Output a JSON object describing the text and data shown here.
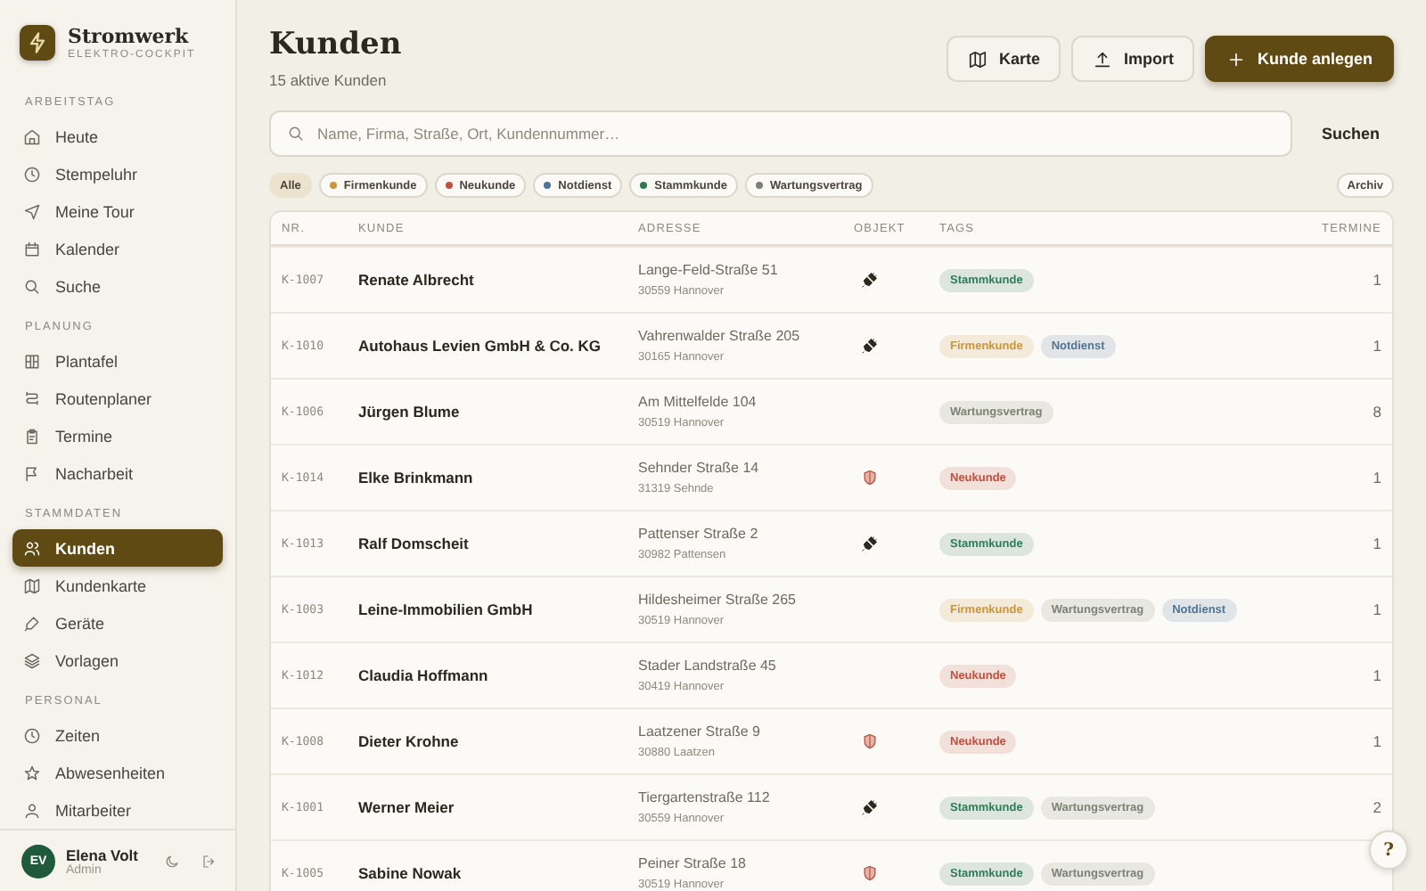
{
  "brand": {
    "name": "Stromwerk",
    "subtitle": "ELEKTRO-COCKPIT"
  },
  "sidebar": {
    "sections": [
      {
        "title": "ARBEITSTAG",
        "items": [
          {
            "label": "Heute",
            "selected": false
          },
          {
            "label": "Stempeluhr",
            "selected": false
          },
          {
            "label": "Meine Tour",
            "selected": false
          },
          {
            "label": "Kalender",
            "selected": false
          },
          {
            "label": "Suche",
            "selected": false
          }
        ]
      },
      {
        "title": "PLANUNG",
        "items": [
          {
            "label": "Plantafel",
            "selected": false
          },
          {
            "label": "Routenplaner",
            "selected": false
          },
          {
            "label": "Termine",
            "selected": false
          },
          {
            "label": "Nacharbeit",
            "selected": false
          }
        ]
      },
      {
        "title": "STAMMDATEN",
        "items": [
          {
            "label": "Kunden",
            "selected": true
          },
          {
            "label": "Kundenkarte",
            "selected": false
          },
          {
            "label": "Geräte",
            "selected": false
          },
          {
            "label": "Vorlagen",
            "selected": false
          }
        ]
      },
      {
        "title": "PERSONAL",
        "items": [
          {
            "label": "Zeiten",
            "selected": false
          },
          {
            "label": "Abwesenheiten",
            "selected": false
          },
          {
            "label": "Mitarbeiter",
            "selected": false
          }
        ]
      }
    ]
  },
  "user": {
    "initials": "EV",
    "name": "Elena Volt",
    "role": "Admin"
  },
  "page": {
    "title": "Kunden",
    "subtitle": "15 aktive Kunden"
  },
  "actions": [
    {
      "label": "Karte",
      "kind": "secondary"
    },
    {
      "label": "Import",
      "kind": "secondary"
    },
    {
      "label": "Kunde anlegen",
      "kind": "primary"
    }
  ],
  "search": {
    "placeholder": "Name, Firma, Straße, Ort, Kundennummer…",
    "button": "Suchen"
  },
  "filters": [
    {
      "label": "Alle",
      "selected": true
    },
    {
      "label": "Firmenkunde",
      "selected": false,
      "color": "#c9963a"
    },
    {
      "label": "Neukunde",
      "selected": false,
      "color": "#c0513f"
    },
    {
      "label": "Notdienst",
      "selected": false,
      "color": "#4f7594"
    },
    {
      "label": "Stammkunde",
      "selected": false,
      "color": "#2f7a57"
    },
    {
      "label": "Wartungsvertrag",
      "selected": false,
      "color": "#7d8273"
    }
  ],
  "archive": "Archiv",
  "table": {
    "columns": [
      "NR.",
      "KUNDE",
      "ADRESSE",
      "OBJEKT",
      "TAGS",
      "TERMINE"
    ],
    "rows": [
      {
        "nr": "K-1007",
        "name": "Renate Albrecht",
        "street": "Lange-Feld-Straße 51",
        "city": "30559 Hannover",
        "object": {
          "kind": "plug"
        },
        "tags": [
          {
            "label": "Stammkunde",
            "color": "#2f7a57"
          }
        ],
        "termine": "1"
      },
      {
        "nr": "K-1010",
        "name": "Autohaus Levien GmbH & Co. KG",
        "street": "Vahrenwalder Straße 205",
        "city": "30165 Hannover",
        "object": {
          "kind": "plug"
        },
        "tags": [
          {
            "label": "Firmenkunde",
            "color": "#c9963a"
          },
          {
            "label": "Notdienst",
            "color": "#4f7594"
          }
        ],
        "termine": "1"
      },
      {
        "nr": "K-1006",
        "name": "Jürgen Blume",
        "street": "Am Mittelfelde 104",
        "city": "30519 Hannover",
        "tags": [
          {
            "label": "Wartungsvertrag",
            "color": "#7d8273"
          }
        ],
        "termine": "8"
      },
      {
        "nr": "K-1014",
        "name": "Elke Brinkmann",
        "street": "Sehnder Straße 14",
        "city": "31319 Sehnde",
        "object": {
          "kind": "shield"
        },
        "tags": [
          {
            "label": "Neukunde",
            "color": "#c0513f"
          }
        ],
        "termine": "1"
      },
      {
        "nr": "K-1013",
        "name": "Ralf Domscheit",
        "street": "Pattenser Straße 2",
        "city": "30982 Pattensen",
        "object": {
          "kind": "plug"
        },
        "tags": [
          {
            "label": "Stammkunde",
            "color": "#2f7a57"
          }
        ],
        "termine": "1"
      },
      {
        "nr": "K-1003",
        "name": "Leine-Immobilien GmbH",
        "street": "Hildesheimer Straße 265",
        "city": "30519 Hannover",
        "tags": [
          {
            "label": "Firmenkunde",
            "color": "#c9963a"
          },
          {
            "label": "Wartungsvertrag",
            "color": "#7d8273"
          },
          {
            "label": "Notdienst",
            "color": "#4f7594"
          }
        ],
        "termine": "1"
      },
      {
        "nr": "K-1012",
        "name": "Claudia Hoffmann",
        "street": "Stader Landstraße 45",
        "city": "30419 Hannover",
        "tags": [
          {
            "label": "Neukunde",
            "color": "#c0513f"
          }
        ],
        "termine": "1"
      },
      {
        "nr": "K-1008",
        "name": "Dieter Krohne",
        "street": "Laatzener Straße 9",
        "city": "30880 Laatzen",
        "object": {
          "kind": "shield"
        },
        "tags": [
          {
            "label": "Neukunde",
            "color": "#c0513f"
          }
        ],
        "termine": "1"
      },
      {
        "nr": "K-1001",
        "name": "Werner Meier",
        "street": "Tiergartenstraße 112",
        "city": "30559 Hannover",
        "object": {
          "kind": "plug"
        },
        "tags": [
          {
            "label": "Stammkunde",
            "color": "#2f7a57"
          },
          {
            "label": "Wartungsvertrag",
            "color": "#7d8273"
          }
        ],
        "termine": "2"
      },
      {
        "nr": "K-1005",
        "name": "Sabine Nowak",
        "street": "Peiner Straße 18",
        "city": "30519 Hannover",
        "object": {
          "kind": "shield"
        },
        "tags": [
          {
            "label": "Stammkunde",
            "color": "#2f7a57"
          },
          {
            "label": "Wartungsvertrag",
            "color": "#7d8273"
          }
        ],
        "termine": ""
      }
    ]
  },
  "help": "?"
}
